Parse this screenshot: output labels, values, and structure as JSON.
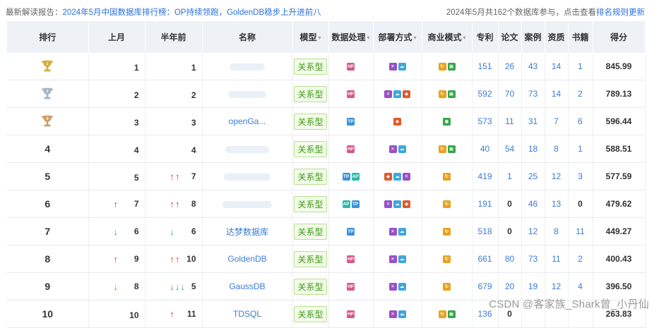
{
  "topbar": {
    "prefix": "最新解读报告：",
    "report_link": "2024年5月中国数据库排行榜：OP持续领跑，GoldenDB稳步上升进前八",
    "right_text": "2024年5月共162个数据库参与，点击查看",
    "rules_link": "排名规则更新"
  },
  "headers": [
    "排行",
    "上月",
    "半年前",
    "名称",
    "模型",
    "数据处理",
    "部署方式",
    "商业模式",
    "专利",
    "论文",
    "案例",
    "资质",
    "书籍",
    "得分"
  ],
  "rows": [
    {
      "rank": "1",
      "rank_trophy": "gold",
      "last_month": "1",
      "lm_arrow": "",
      "half_year": "1",
      "hy_arrow": "",
      "name": "",
      "model": "关系型",
      "proc": [
        "HP"
      ],
      "deploy": [
        "x",
        "c"
      ],
      "biz": [
        "y",
        "g"
      ],
      "patent": "151",
      "paper": "26",
      "case": "43",
      "qual": "14",
      "book": "1",
      "score": "845.99"
    },
    {
      "rank": "2",
      "rank_trophy": "silver",
      "last_month": "2",
      "lm_arrow": "",
      "half_year": "2",
      "hy_arrow": "",
      "name": "",
      "model": "关系型",
      "proc": [
        "HP"
      ],
      "deploy": [
        "x",
        "c",
        "o"
      ],
      "biz": [
        "y",
        "g"
      ],
      "patent": "592",
      "paper": "70",
      "case": "73",
      "qual": "14",
      "book": "2",
      "score": "789.13"
    },
    {
      "rank": "3",
      "rank_trophy": "bronze",
      "last_month": "3",
      "lm_arrow": "",
      "half_year": "3",
      "hy_arrow": "",
      "name": "openGa...",
      "model": "关系型",
      "proc": [
        "TP"
      ],
      "deploy": [
        "o"
      ],
      "biz": [
        "g"
      ],
      "patent": "573",
      "paper": "11",
      "case": "31",
      "qual": "7",
      "book": "6",
      "score": "596.44"
    },
    {
      "rank": "4",
      "rank_trophy": "",
      "last_month": "4",
      "lm_arrow": "",
      "half_year": "4",
      "hy_arrow": "",
      "name": "",
      "model": "关系型",
      "proc": [
        "HP"
      ],
      "deploy": [
        "x",
        "c"
      ],
      "biz": [
        "y",
        "g"
      ],
      "patent": "40",
      "paper": "54",
      "case": "18",
      "qual": "8",
      "book": "1",
      "score": "588.51"
    },
    {
      "rank": "5",
      "rank_trophy": "",
      "last_month": "5",
      "lm_arrow": "",
      "half_year": "7",
      "hy_arrow": "↑↑",
      "hy_dir": "up",
      "name": "",
      "model": "关系型",
      "proc": [
        "TP",
        "AP"
      ],
      "deploy": [
        "o",
        "c",
        "x"
      ],
      "biz": [
        "y"
      ],
      "patent": "419",
      "paper": "1",
      "case": "25",
      "qual": "12",
      "book": "3",
      "score": "577.59"
    },
    {
      "rank": "6",
      "rank_trophy": "",
      "last_month": "7",
      "lm_arrow": "↑",
      "lm_dir": "up",
      "half_year": "8",
      "hy_arrow": "↑↑",
      "hy_dir": "up",
      "name": "",
      "model": "关系型",
      "proc": [
        "AP",
        "TP"
      ],
      "deploy": [
        "x",
        "c",
        "o"
      ],
      "biz": [
        "y"
      ],
      "patent": "191",
      "paper": "0",
      "case": "46",
      "qual": "13",
      "book": "0",
      "score": "479.62"
    },
    {
      "rank": "7",
      "rank_trophy": "",
      "last_month": "6",
      "lm_arrow": "↓",
      "lm_dir": "down",
      "half_year": "6",
      "hy_arrow": "↓",
      "hy_dir": "down",
      "name": "达梦数据库",
      "model": "关系型",
      "proc": [
        "TP"
      ],
      "deploy": [
        "x",
        "c"
      ],
      "biz": [
        "y"
      ],
      "patent": "518",
      "paper": "0",
      "case": "12",
      "qual": "8",
      "book": "11",
      "score": "449.27"
    },
    {
      "rank": "8",
      "rank_trophy": "",
      "last_month": "9",
      "lm_arrow": "↑",
      "lm_dir": "up",
      "half_year": "10",
      "hy_arrow": "↑↑",
      "hy_dir": "up",
      "name": "GoldenDB",
      "model": "关系型",
      "proc": [
        "HP"
      ],
      "deploy": [
        "x",
        "c"
      ],
      "biz": [
        "y"
      ],
      "patent": "661",
      "paper": "80",
      "case": "73",
      "qual": "11",
      "book": "2",
      "score": "400.43"
    },
    {
      "rank": "9",
      "rank_trophy": "",
      "last_month": "8",
      "lm_arrow": "↓",
      "lm_dir": "down",
      "half_year": "5",
      "hy_arrow": "↓↓↓",
      "hy_dir": "down",
      "name": "GaussDB",
      "model": "关系型",
      "proc": [
        "HP"
      ],
      "deploy": [
        "x",
        "c"
      ],
      "biz": [
        "y"
      ],
      "patent": "679",
      "paper": "20",
      "case": "19",
      "qual": "12",
      "book": "4",
      "score": "396.50"
    },
    {
      "rank": "10",
      "rank_trophy": "",
      "last_month": "10",
      "lm_arrow": "",
      "half_year": "11",
      "hy_arrow": "↑",
      "hy_dir": "up",
      "name": "TDSQL",
      "model": "关系型",
      "proc": [
        "HP"
      ],
      "deploy": [
        "x",
        "c"
      ],
      "biz": [
        "y",
        "g"
      ],
      "patent": "136",
      "paper": "0",
      "case": "",
      "qual": "",
      "book": "",
      "score": "263.83"
    }
  ],
  "watermark": "CSDN @客家族_Shark曾_小丹仙",
  "colors": {
    "accent": "#3a7bd5",
    "header_bg": "#eef1f6",
    "tag_green": "#3b9a12",
    "up": "#ee3333",
    "down": "#2fb24a"
  }
}
